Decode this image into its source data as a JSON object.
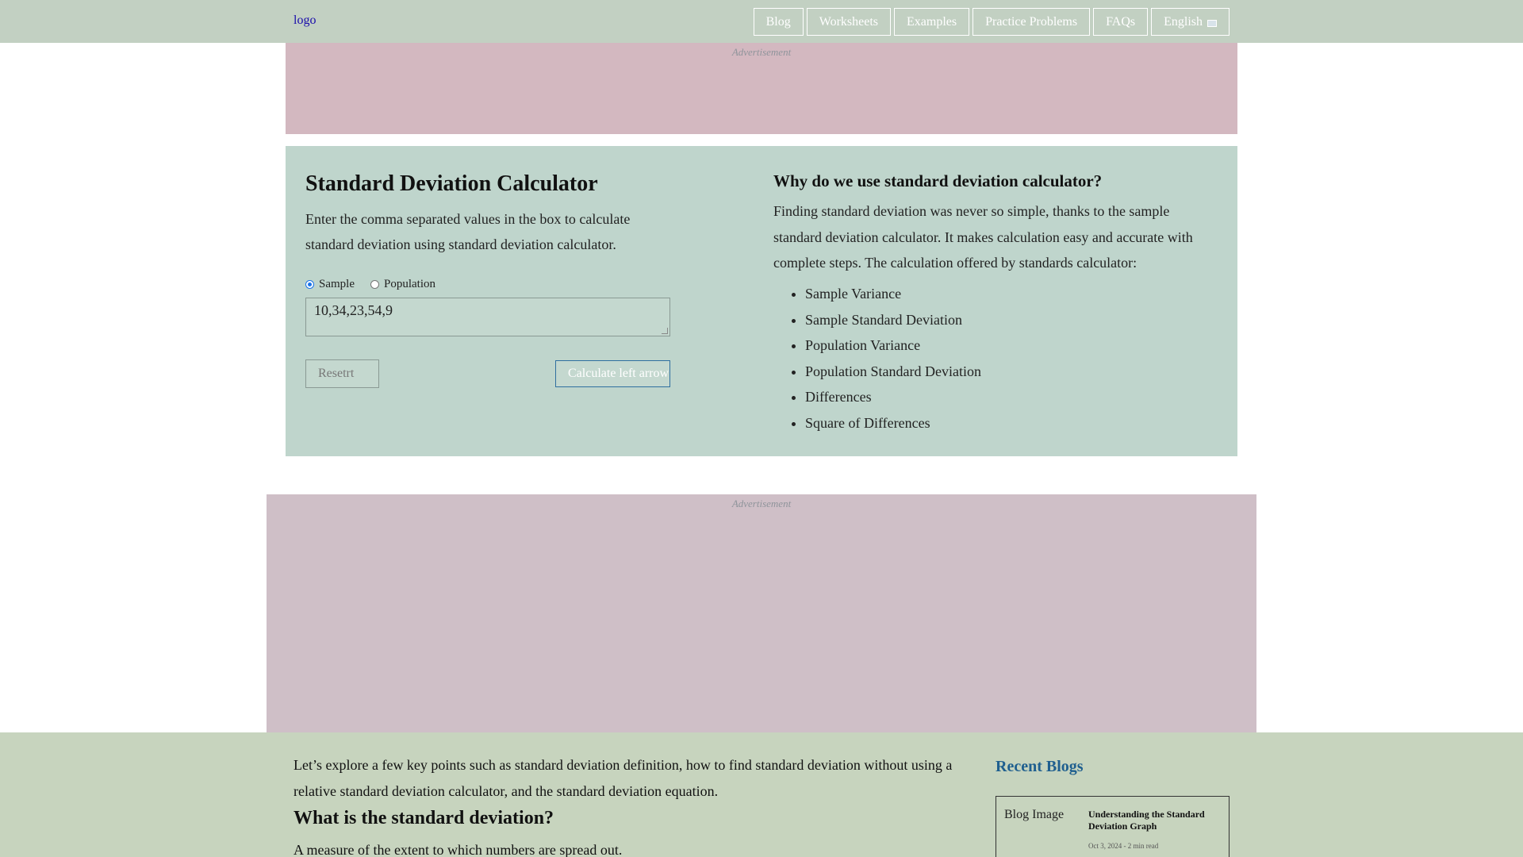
{
  "header": {
    "logo_alt": "logo",
    "nav": [
      {
        "label": "Blog"
      },
      {
        "label": "Worksheets"
      },
      {
        "label": "Examples"
      },
      {
        "label": "Practice Problems"
      },
      {
        "label": "FAQs"
      },
      {
        "label": "English"
      }
    ]
  },
  "ads": {
    "label": "Advertisement"
  },
  "calculator": {
    "title": "Standard Deviation Calculator",
    "description": "Enter the comma separated values in the box to calculate standard deviation using standard deviation calculator.",
    "radio_sample": "Sample",
    "radio_population": "Population",
    "selected": "Sample",
    "input_value": "10,34,23,54,9",
    "reset_label": "Reset",
    "reset_icon_alt": "rt",
    "calculate_label": "Calculate",
    "calculate_icon_alt": "left arrow"
  },
  "why": {
    "title": "Why do we use standard deviation calculator?",
    "description": "Finding standard deviation was never so simple, thanks to the sample standard deviation calculator. It makes calculation easy and accurate with complete steps. The calculation offered by standards calculator:",
    "items": [
      "Sample Variance",
      "Sample Standard Deviation",
      "Population Variance",
      "Population Standard Deviation",
      "Differences",
      "Square of Differences"
    ]
  },
  "content": {
    "intro": "Let’s explore a few key points such as standard deviation definition, how to find standard deviation without using a relative standard deviation calculator, and the standard deviation equation.",
    "heading": "What is the standard deviation?",
    "definition": "A measure of the extent to which numbers are spread out."
  },
  "recent": {
    "title": "Recent Blogs",
    "cards": [
      {
        "image_alt": "Blog Image",
        "title": "Understanding the Standard Deviation Graph",
        "meta": "Oct 3, 2024 - 2 min read"
      }
    ]
  },
  "colors": {
    "topbar": "#c2d0c2",
    "calculator_bg": "#bfd5cc",
    "ad_bg": "#d3b8c0",
    "accent_link": "#1f5f8f"
  }
}
